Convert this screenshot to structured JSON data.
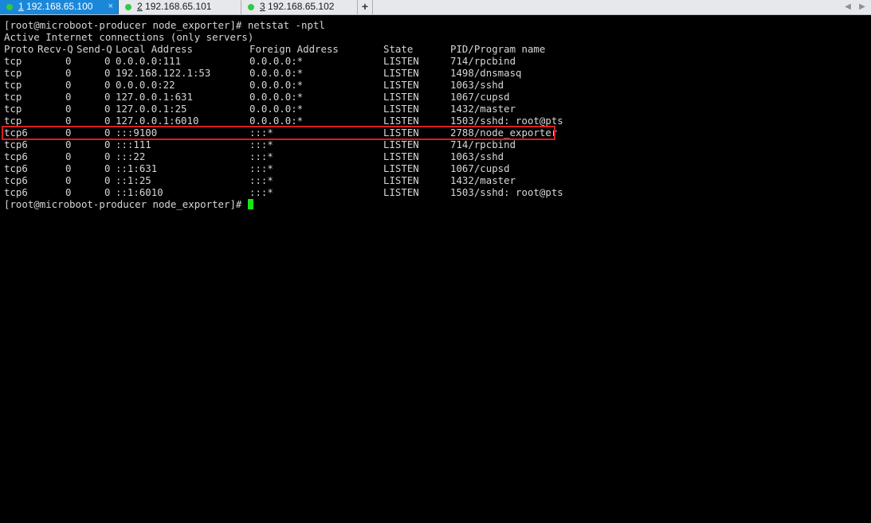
{
  "tabs": [
    {
      "number": "1",
      "host": " 192.168.65.100",
      "close": "×",
      "dot_color": "#2ecc40"
    },
    {
      "number": "2",
      "host": " 192.168.65.101",
      "dot_color": "#2ecc40"
    },
    {
      "number": "3",
      "host": " 192.168.65.102",
      "dot_color": "#2ecc40"
    }
  ],
  "tab_add_label": "+",
  "colors": {
    "active_tab": "#1b87d9",
    "highlight_border": "#d81f1f",
    "cursor": "#18e418",
    "terminal_text": "#d6d6d6"
  },
  "terminal": {
    "command_line": "[root@microboot-producer node_exporter]# netstat -nptl",
    "info_line": "Active Internet connections (only servers)",
    "headers": {
      "proto": "Proto",
      "recvq": "Recv-Q",
      "sendq": "Send-Q",
      "local": "Local Address",
      "foreign": "Foreign Address",
      "state": "State",
      "pid": "PID/Program name"
    },
    "rows": [
      {
        "proto": "tcp",
        "recvq": "0",
        "sendq": "0",
        "local": "0.0.0.0:111",
        "foreign": "0.0.0.0:*",
        "state": "LISTEN",
        "pid": "714/rpcbind"
      },
      {
        "proto": "tcp",
        "recvq": "0",
        "sendq": "0",
        "local": "192.168.122.1:53",
        "foreign": "0.0.0.0:*",
        "state": "LISTEN",
        "pid": "1498/dnsmasq"
      },
      {
        "proto": "tcp",
        "recvq": "0",
        "sendq": "0",
        "local": "0.0.0.0:22",
        "foreign": "0.0.0.0:*",
        "state": "LISTEN",
        "pid": "1063/sshd"
      },
      {
        "proto": "tcp",
        "recvq": "0",
        "sendq": "0",
        "local": "127.0.0.1:631",
        "foreign": "0.0.0.0:*",
        "state": "LISTEN",
        "pid": "1067/cupsd"
      },
      {
        "proto": "tcp",
        "recvq": "0",
        "sendq": "0",
        "local": "127.0.0.1:25",
        "foreign": "0.0.0.0:*",
        "state": "LISTEN",
        "pid": "1432/master"
      },
      {
        "proto": "tcp",
        "recvq": "0",
        "sendq": "0",
        "local": "127.0.0.1:6010",
        "foreign": "0.0.0.0:*",
        "state": "LISTEN",
        "pid": "1503/sshd: root@pts"
      },
      {
        "proto": "tcp6",
        "recvq": "0",
        "sendq": "0",
        "local": ":::9100",
        "foreign": ":::*",
        "state": "LISTEN",
        "pid": "2788/node_exporter"
      },
      {
        "proto": "tcp6",
        "recvq": "0",
        "sendq": "0",
        "local": ":::111",
        "foreign": ":::*",
        "state": "LISTEN",
        "pid": "714/rpcbind"
      },
      {
        "proto": "tcp6",
        "recvq": "0",
        "sendq": "0",
        "local": ":::22",
        "foreign": ":::*",
        "state": "LISTEN",
        "pid": "1063/sshd"
      },
      {
        "proto": "tcp6",
        "recvq": "0",
        "sendq": "0",
        "local": "::1:631",
        "foreign": ":::*",
        "state": "LISTEN",
        "pid": "1067/cupsd"
      },
      {
        "proto": "tcp6",
        "recvq": "0",
        "sendq": "0",
        "local": "::1:25",
        "foreign": ":::*",
        "state": "LISTEN",
        "pid": "1432/master"
      },
      {
        "proto": "tcp6",
        "recvq": "0",
        "sendq": "0",
        "local": "::1:6010",
        "foreign": ":::*",
        "state": "LISTEN",
        "pid": "1503/sshd: root@pts"
      }
    ],
    "prompt": "[root@microboot-producer node_exporter]# "
  }
}
